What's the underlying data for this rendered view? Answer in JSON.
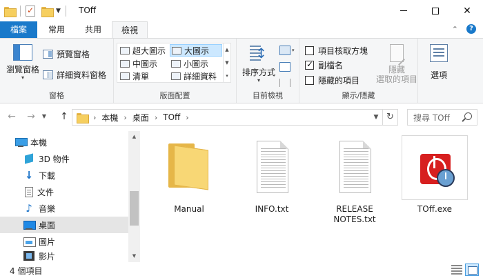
{
  "title": "TOff",
  "tabs": {
    "file": "檔案",
    "home": "常用",
    "share": "共用",
    "view": "檢視"
  },
  "ribbon": {
    "panes": {
      "label": "窗格",
      "navigation_pane": "瀏覽窗格",
      "preview_pane": "預覽窗格",
      "details_pane": "詳細資料窗格"
    },
    "layout": {
      "label": "版面配置",
      "items": [
        "超大圖示",
        "大圖示",
        "中圖示",
        "小圖示",
        "清單",
        "詳細資料"
      ],
      "selected": "大圖示"
    },
    "current_view": {
      "label": "目前檢視",
      "sort_by": "排序方式"
    },
    "show_hide": {
      "label": "顯示/隱藏",
      "item_checkboxes": "項目核取方塊",
      "item_checkboxes_checked": false,
      "file_name_extensions": "副檔名",
      "file_name_extensions_checked": true,
      "hidden_items": "隱藏的項目",
      "hidden_items_checked": false,
      "hide_selected_line1": "隱藏",
      "hide_selected_line2": "選取的項目"
    },
    "options": {
      "label": "選項"
    }
  },
  "address": {
    "crumbs": [
      "本機",
      "桌面",
      "TOff"
    ],
    "search_placeholder": "搜尋 TOff"
  },
  "nav_pane": {
    "items": [
      {
        "label": "本機",
        "icon": "this-pc-icon"
      },
      {
        "label": "3D 物件",
        "icon": "3d-objects-icon"
      },
      {
        "label": "下載",
        "icon": "downloads-icon"
      },
      {
        "label": "文件",
        "icon": "documents-icon"
      },
      {
        "label": "音樂",
        "icon": "music-icon"
      },
      {
        "label": "桌面",
        "icon": "desktop-icon"
      },
      {
        "label": "圖片",
        "icon": "pictures-icon"
      },
      {
        "label": "影片",
        "icon": "videos-icon"
      }
    ],
    "selected": "桌面"
  },
  "files": [
    {
      "name": "Manual",
      "type": "folder"
    },
    {
      "name": "INFO.txt",
      "type": "text"
    },
    {
      "name_line1": "RELEASE",
      "name_line2": "NOTES.txt",
      "type": "text"
    },
    {
      "name": "TOff.exe",
      "type": "exe"
    }
  ],
  "status": {
    "count_text": "4 個項目"
  },
  "colors": {
    "file_tab": "#1979ca",
    "selection": "#cce8ff",
    "nav_selected": "#e5e5e5"
  }
}
